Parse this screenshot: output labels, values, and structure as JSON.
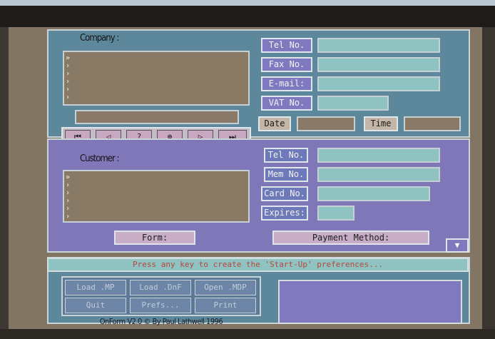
{
  "company": {
    "label": "Company :",
    "list_arrows": "»\n›\n›\n›\n›\n›",
    "tel_label": "Tel No.",
    "fax_label": "Fax No.",
    "email_label": "E-mail:",
    "vat_label": "VAT No.",
    "date_label": "Date",
    "time_label": "Time"
  },
  "nav": {
    "first": "⏮",
    "prev": "◁",
    "query": "?",
    "new": "⊕",
    "next": "▷",
    "last": "⏭"
  },
  "customer": {
    "label": "Customer :",
    "list_arrows": "»\n›\n›\n›\n›\n›",
    "tel_label": "Tel No.",
    "mem_label": "Mem No.",
    "card_label": "Card No.",
    "expires_label": "Expires:",
    "form_label": "Form:",
    "payment_label": "Payment Method:"
  },
  "status": {
    "message": "Press any key to create the 'Start-Up' preferences...",
    "buttons": [
      "Load .MP",
      "Load .DnF",
      "Open .MDP",
      "Quit",
      "Prefs...",
      "Print"
    ],
    "credits": "OnForm V2.0 © By Paul Lathwell 1996",
    "corner_icon": "▼"
  }
}
